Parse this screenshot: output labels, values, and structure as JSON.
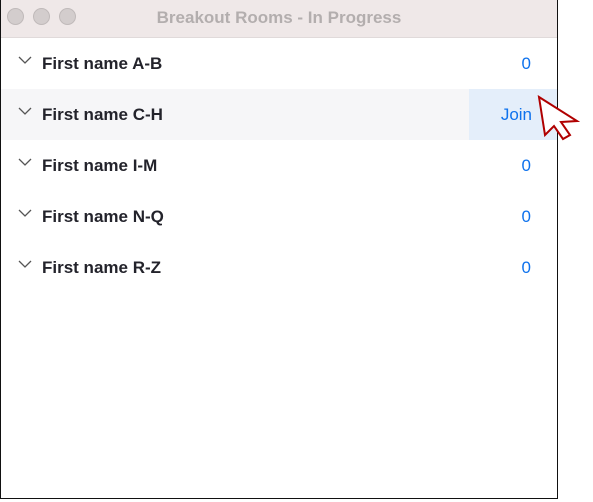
{
  "window": {
    "title": "Breakout Rooms - In Progress"
  },
  "rooms": [
    {
      "name": "First name A-B",
      "count": "0"
    },
    {
      "name": "First name C-H",
      "action": "Join"
    },
    {
      "name": "First name I-M",
      "count": "0"
    },
    {
      "name": "First name N-Q",
      "count": "0"
    },
    {
      "name": "First name R-Z",
      "count": "0"
    }
  ],
  "colors": {
    "accent": "#0e72ed",
    "cursor": "#b00000"
  }
}
